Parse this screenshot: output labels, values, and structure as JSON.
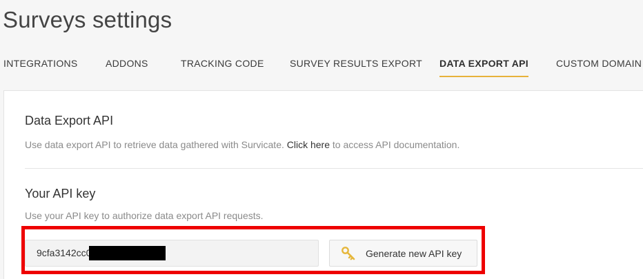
{
  "header": {
    "title": "Surveys settings"
  },
  "tabs": [
    {
      "label": "INTEGRATIONS",
      "active": false
    },
    {
      "label": "ADDONS",
      "active": false
    },
    {
      "label": "TRACKING CODE",
      "active": false
    },
    {
      "label": "SURVEY RESULTS EXPORT",
      "active": false
    },
    {
      "label": "DATA EXPORT API",
      "active": true
    },
    {
      "label": "CUSTOM DOMAIN",
      "active": false
    }
  ],
  "data_export": {
    "title": "Data Export API",
    "desc_prefix": "Use data export API to retrieve data gathered with Survicate. ",
    "desc_link": "Click here",
    "desc_suffix": " to access API documentation."
  },
  "api_key": {
    "title": "Your API key",
    "desc": "Use your API key to authorize data export API requests.",
    "value": "9cfa3142cc0                              b261df70",
    "generate_label": "Generate new API key"
  },
  "colors": {
    "accent_underline": "#e7b23a",
    "highlight_border": "#ee0000",
    "key_icon": "#e6b73b"
  },
  "icons": {
    "generate": "key-icon"
  }
}
